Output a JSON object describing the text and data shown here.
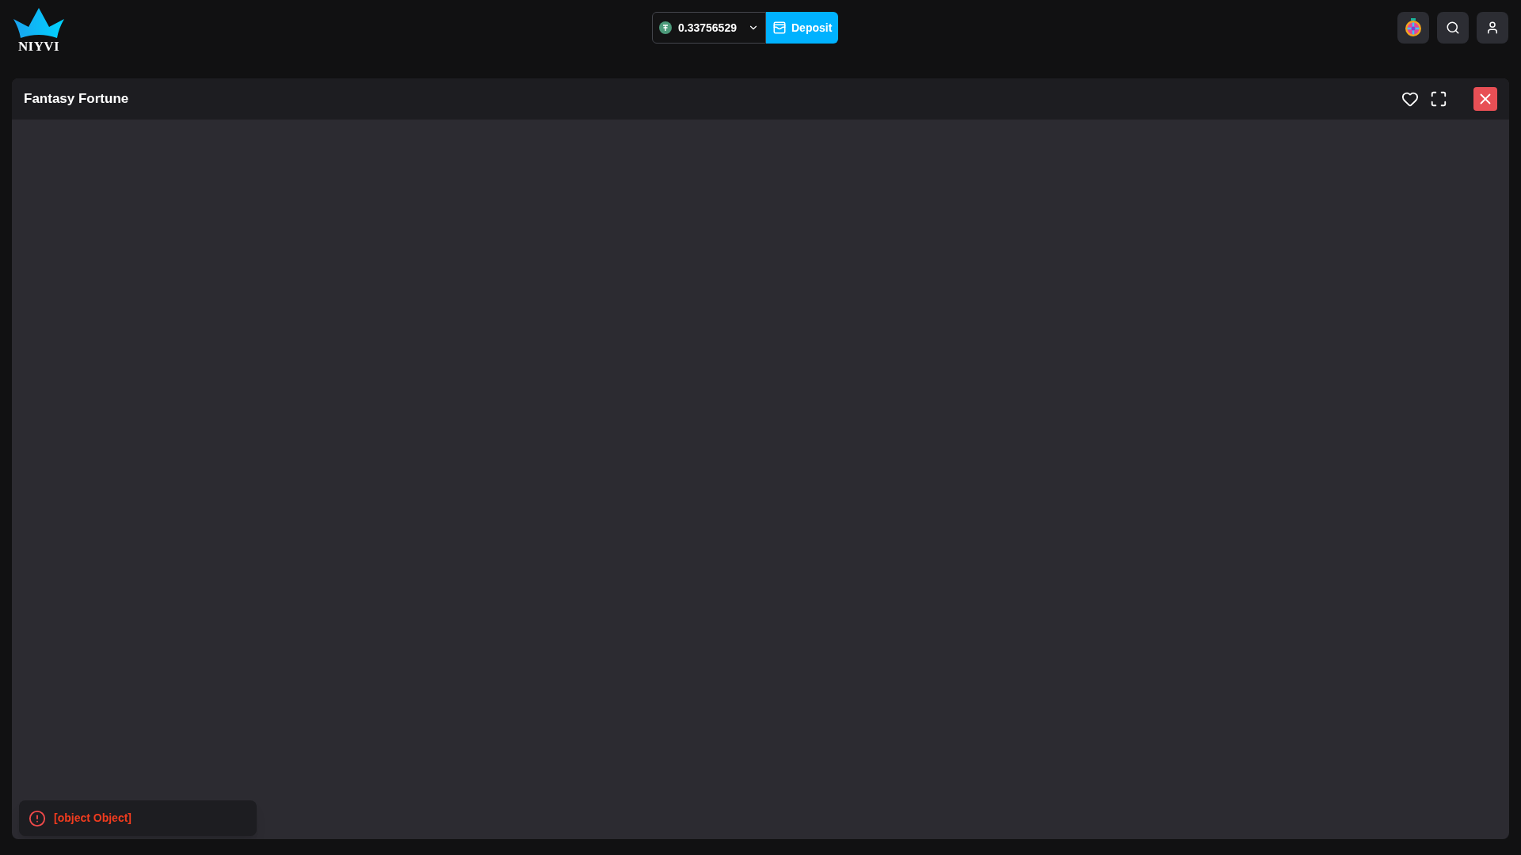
{
  "logo": {
    "text": "NIYVI"
  },
  "wallet": {
    "balance": "0.33756529",
    "deposit_label": "Deposit"
  },
  "game": {
    "title": "Fantasy Fortune"
  },
  "toast": {
    "kind": "error",
    "message": "[object Object]"
  }
}
